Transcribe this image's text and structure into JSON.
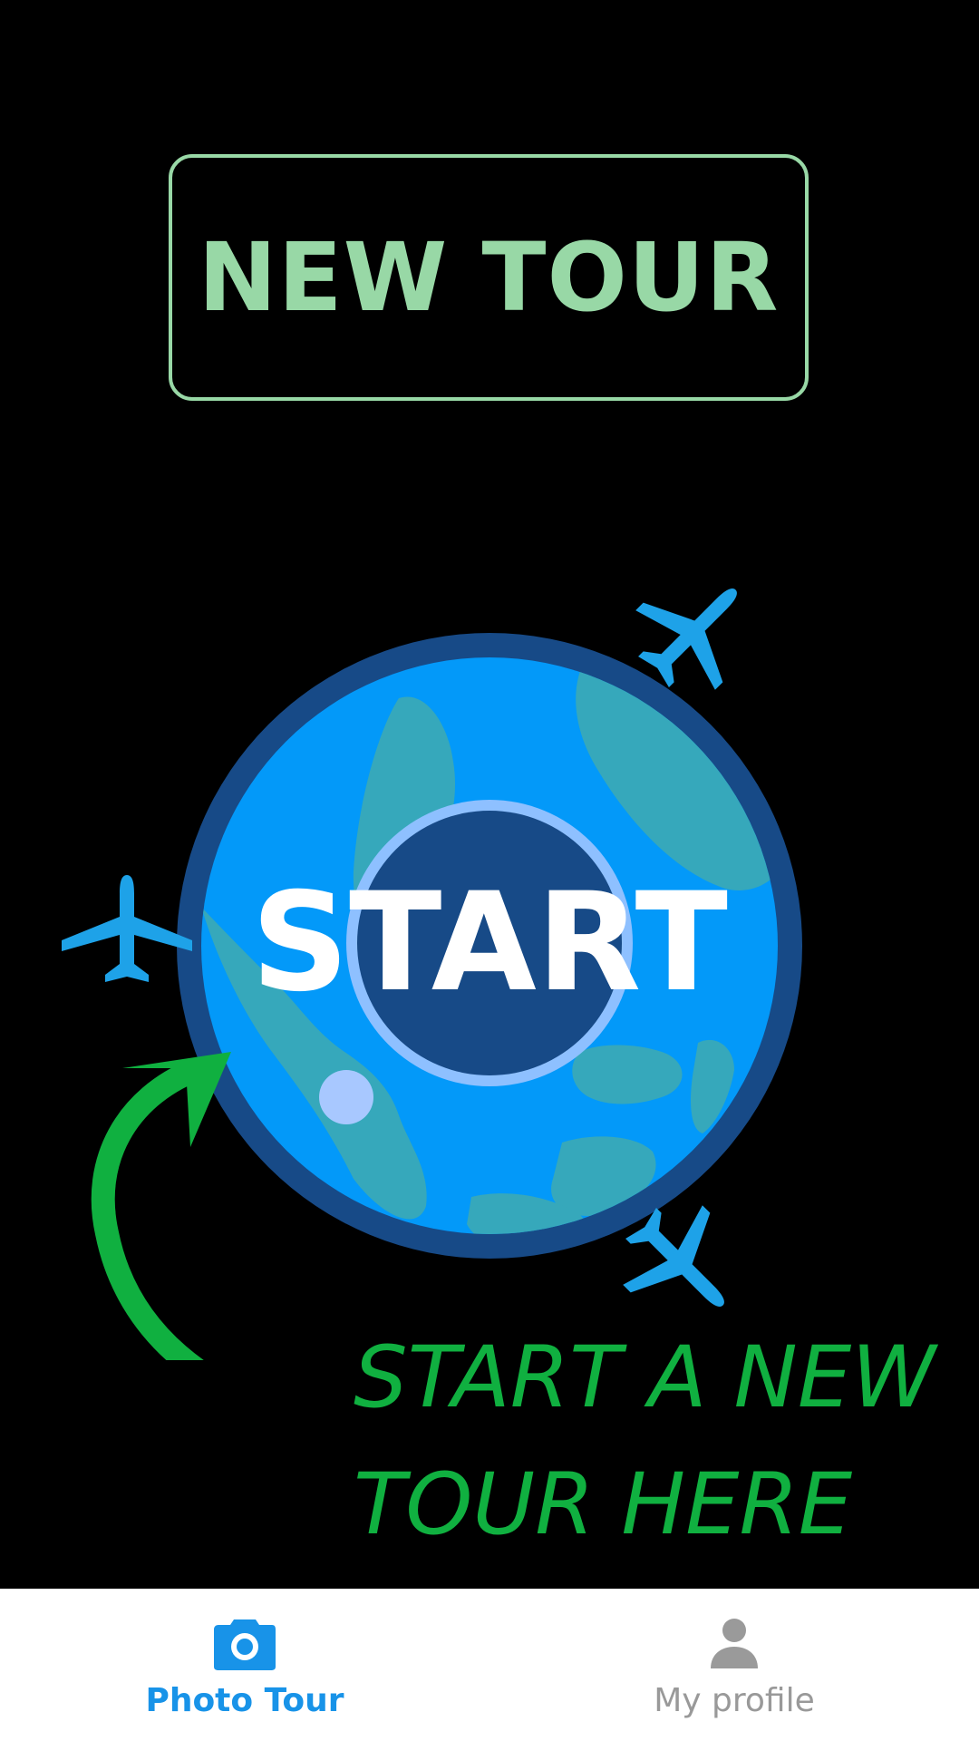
{
  "header": {
    "new_tour_label": "NEW TOUR"
  },
  "main": {
    "start_label": "START",
    "hint_line_1": "START A NEW",
    "hint_line_2": "TOUR HERE",
    "icons": [
      "airplane-icon",
      "globe-icon",
      "arrow-icon"
    ]
  },
  "bottom_nav": {
    "items": [
      {
        "label": "Photo Tour",
        "icon": "camera-icon",
        "active": true
      },
      {
        "label": "My profile",
        "icon": "person-icon",
        "active": false
      }
    ]
  },
  "colors": {
    "background": "#000000",
    "new_tour_accent": "#98d8a6",
    "globe_ocean": "#0399f9",
    "globe_land": "#36a8bb",
    "globe_rim": "#174a87",
    "globe_inner_ring": "#8ec0ff",
    "hint_green": "#10b040",
    "active_tab": "#1893e8",
    "inactive_tab": "#999999",
    "nav_background": "#ffffff"
  }
}
